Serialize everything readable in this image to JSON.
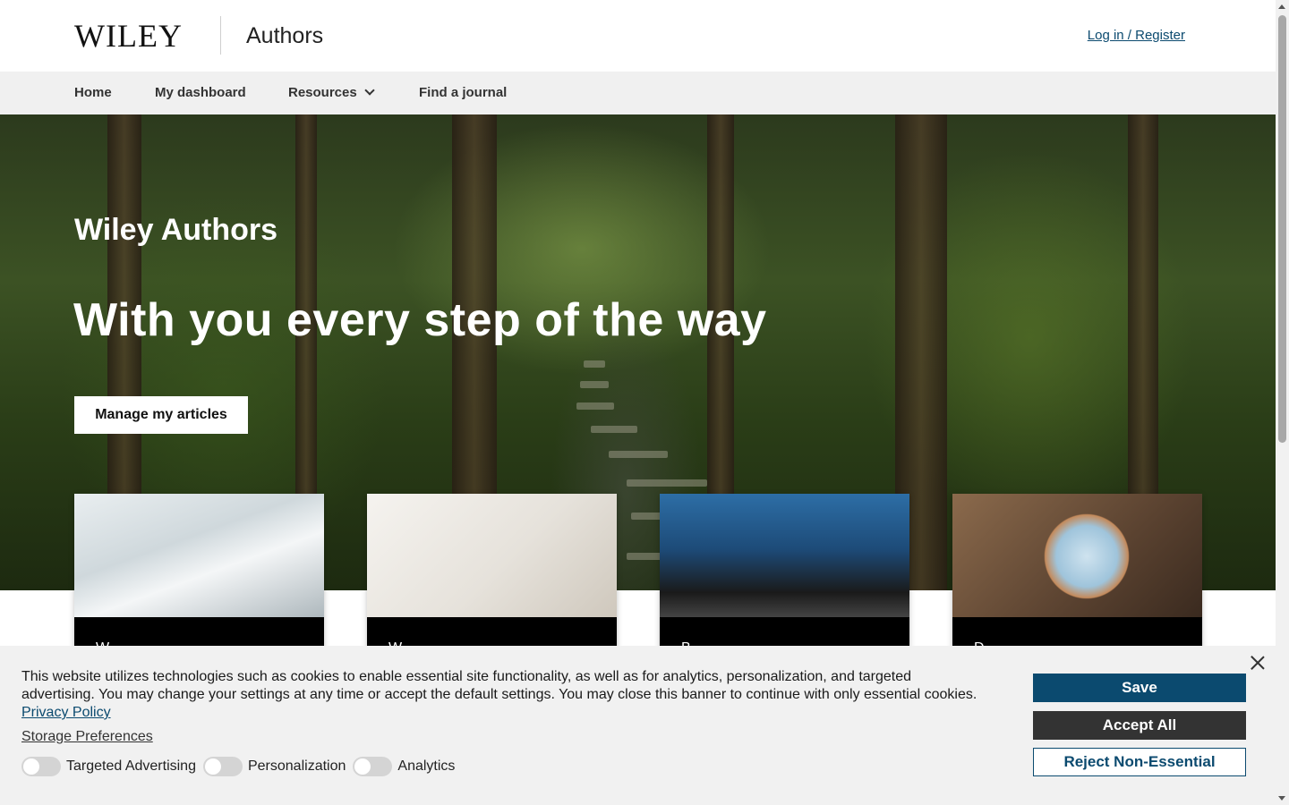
{
  "header": {
    "logo": "WILEY",
    "site_name": "Authors",
    "login_label": "Log in / Register"
  },
  "nav": {
    "items": [
      {
        "label": "Home"
      },
      {
        "label": "My dashboard"
      },
      {
        "label": "Resources",
        "icon": "chevron-down-icon"
      },
      {
        "label": "Find a journal"
      }
    ]
  },
  "hero": {
    "subtitle": "Wiley Authors",
    "title": "With you every step of the way",
    "button_label": "Manage my articles"
  },
  "cards": [
    {
      "caption": "W...",
      "image": "library-interior"
    },
    {
      "caption": "W...",
      "image": "hand-writing"
    },
    {
      "caption": "B...",
      "image": "man-at-laptop"
    },
    {
      "caption": "D...",
      "image": "tent-view"
    }
  ],
  "cookie_banner": {
    "text": "This website utilizes technologies such as cookies to enable essential site functionality, as well as for analytics, personalization, and targeted advertising. You may change your settings at any time or accept the default settings. You may close this banner to continue with only essential cookies.",
    "privacy_link": "Privacy Policy",
    "storage_preferences": "Storage Preferences",
    "toggles": [
      {
        "label": "Targeted Advertising",
        "on": false
      },
      {
        "label": "Personalization",
        "on": false
      },
      {
        "label": "Analytics",
        "on": false
      }
    ],
    "save_label": "Save",
    "accept_label": "Accept All",
    "reject_label": "Reject Non-Essential"
  },
  "colors": {
    "brand_blue": "#0b4a6f",
    "dark_button": "#333333",
    "nav_bg": "#f0f0f0",
    "banner_bg": "#f1f1f1"
  }
}
